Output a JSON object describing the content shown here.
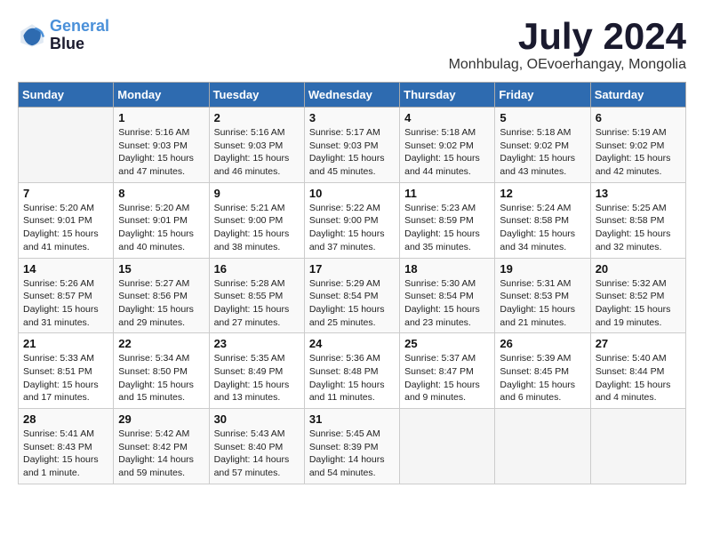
{
  "logo": {
    "line1": "General",
    "line2": "Blue"
  },
  "title": "July 2024",
  "location": "Monhbulag, OEvoerhangay, Mongolia",
  "days_header": [
    "Sunday",
    "Monday",
    "Tuesday",
    "Wednesday",
    "Thursday",
    "Friday",
    "Saturday"
  ],
  "weeks": [
    [
      {
        "day": "",
        "info": ""
      },
      {
        "day": "1",
        "info": "Sunrise: 5:16 AM\nSunset: 9:03 PM\nDaylight: 15 hours\nand 47 minutes."
      },
      {
        "day": "2",
        "info": "Sunrise: 5:16 AM\nSunset: 9:03 PM\nDaylight: 15 hours\nand 46 minutes."
      },
      {
        "day": "3",
        "info": "Sunrise: 5:17 AM\nSunset: 9:03 PM\nDaylight: 15 hours\nand 45 minutes."
      },
      {
        "day": "4",
        "info": "Sunrise: 5:18 AM\nSunset: 9:02 PM\nDaylight: 15 hours\nand 44 minutes."
      },
      {
        "day": "5",
        "info": "Sunrise: 5:18 AM\nSunset: 9:02 PM\nDaylight: 15 hours\nand 43 minutes."
      },
      {
        "day": "6",
        "info": "Sunrise: 5:19 AM\nSunset: 9:02 PM\nDaylight: 15 hours\nand 42 minutes."
      }
    ],
    [
      {
        "day": "7",
        "info": "Sunrise: 5:20 AM\nSunset: 9:01 PM\nDaylight: 15 hours\nand 41 minutes."
      },
      {
        "day": "8",
        "info": "Sunrise: 5:20 AM\nSunset: 9:01 PM\nDaylight: 15 hours\nand 40 minutes."
      },
      {
        "day": "9",
        "info": "Sunrise: 5:21 AM\nSunset: 9:00 PM\nDaylight: 15 hours\nand 38 minutes."
      },
      {
        "day": "10",
        "info": "Sunrise: 5:22 AM\nSunset: 9:00 PM\nDaylight: 15 hours\nand 37 minutes."
      },
      {
        "day": "11",
        "info": "Sunrise: 5:23 AM\nSunset: 8:59 PM\nDaylight: 15 hours\nand 35 minutes."
      },
      {
        "day": "12",
        "info": "Sunrise: 5:24 AM\nSunset: 8:58 PM\nDaylight: 15 hours\nand 34 minutes."
      },
      {
        "day": "13",
        "info": "Sunrise: 5:25 AM\nSunset: 8:58 PM\nDaylight: 15 hours\nand 32 minutes."
      }
    ],
    [
      {
        "day": "14",
        "info": "Sunrise: 5:26 AM\nSunset: 8:57 PM\nDaylight: 15 hours\nand 31 minutes."
      },
      {
        "day": "15",
        "info": "Sunrise: 5:27 AM\nSunset: 8:56 PM\nDaylight: 15 hours\nand 29 minutes."
      },
      {
        "day": "16",
        "info": "Sunrise: 5:28 AM\nSunset: 8:55 PM\nDaylight: 15 hours\nand 27 minutes."
      },
      {
        "day": "17",
        "info": "Sunrise: 5:29 AM\nSunset: 8:54 PM\nDaylight: 15 hours\nand 25 minutes."
      },
      {
        "day": "18",
        "info": "Sunrise: 5:30 AM\nSunset: 8:54 PM\nDaylight: 15 hours\nand 23 minutes."
      },
      {
        "day": "19",
        "info": "Sunrise: 5:31 AM\nSunset: 8:53 PM\nDaylight: 15 hours\nand 21 minutes."
      },
      {
        "day": "20",
        "info": "Sunrise: 5:32 AM\nSunset: 8:52 PM\nDaylight: 15 hours\nand 19 minutes."
      }
    ],
    [
      {
        "day": "21",
        "info": "Sunrise: 5:33 AM\nSunset: 8:51 PM\nDaylight: 15 hours\nand 17 minutes."
      },
      {
        "day": "22",
        "info": "Sunrise: 5:34 AM\nSunset: 8:50 PM\nDaylight: 15 hours\nand 15 minutes."
      },
      {
        "day": "23",
        "info": "Sunrise: 5:35 AM\nSunset: 8:49 PM\nDaylight: 15 hours\nand 13 minutes."
      },
      {
        "day": "24",
        "info": "Sunrise: 5:36 AM\nSunset: 8:48 PM\nDaylight: 15 hours\nand 11 minutes."
      },
      {
        "day": "25",
        "info": "Sunrise: 5:37 AM\nSunset: 8:47 PM\nDaylight: 15 hours\nand 9 minutes."
      },
      {
        "day": "26",
        "info": "Sunrise: 5:39 AM\nSunset: 8:45 PM\nDaylight: 15 hours\nand 6 minutes."
      },
      {
        "day": "27",
        "info": "Sunrise: 5:40 AM\nSunset: 8:44 PM\nDaylight: 15 hours\nand 4 minutes."
      }
    ],
    [
      {
        "day": "28",
        "info": "Sunrise: 5:41 AM\nSunset: 8:43 PM\nDaylight: 15 hours\nand 1 minute."
      },
      {
        "day": "29",
        "info": "Sunrise: 5:42 AM\nSunset: 8:42 PM\nDaylight: 14 hours\nand 59 minutes."
      },
      {
        "day": "30",
        "info": "Sunrise: 5:43 AM\nSunset: 8:40 PM\nDaylight: 14 hours\nand 57 minutes."
      },
      {
        "day": "31",
        "info": "Sunrise: 5:45 AM\nSunset: 8:39 PM\nDaylight: 14 hours\nand 54 minutes."
      },
      {
        "day": "",
        "info": ""
      },
      {
        "day": "",
        "info": ""
      },
      {
        "day": "",
        "info": ""
      }
    ]
  ]
}
